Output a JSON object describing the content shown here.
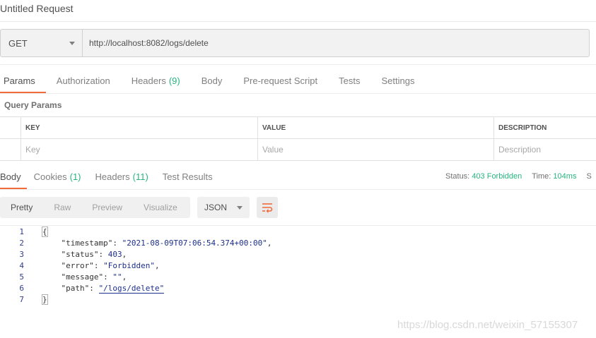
{
  "request": {
    "title": "Untitled Request",
    "method": "GET",
    "url": "http://localhost:8082/logs/delete"
  },
  "request_tabs": [
    {
      "label": "Params",
      "count": "",
      "active": true
    },
    {
      "label": "Authorization",
      "count": "",
      "active": false
    },
    {
      "label": "Headers",
      "count": "(9)",
      "active": false
    },
    {
      "label": "Body",
      "count": "",
      "active": false
    },
    {
      "label": "Pre-request Script",
      "count": "",
      "active": false
    },
    {
      "label": "Tests",
      "count": "",
      "active": false
    },
    {
      "label": "Settings",
      "count": "",
      "active": false
    }
  ],
  "query_params": {
    "label": "Query Params",
    "headers": {
      "key": "KEY",
      "value": "VALUE",
      "description": "DESCRIPTION"
    },
    "placeholders": {
      "key": "Key",
      "value": "Value",
      "description": "Description"
    }
  },
  "response_tabs": [
    {
      "label": "Body",
      "count": "",
      "active": true
    },
    {
      "label": "Cookies",
      "count": "(1)",
      "active": false
    },
    {
      "label": "Headers",
      "count": "(11)",
      "active": false
    },
    {
      "label": "Test Results",
      "count": "",
      "active": false
    }
  ],
  "response_status": {
    "status_label": "Status:",
    "status_value": "403 Forbidden",
    "time_label": "Time:",
    "time_value": "104ms",
    "cut_char": "S"
  },
  "view_modes": [
    "Pretty",
    "Raw",
    "Preview",
    "Visualize"
  ],
  "format": "JSON",
  "code": {
    "lines": [
      "1",
      "2",
      "3",
      "4",
      "5",
      "6",
      "7"
    ],
    "open_brace": "{",
    "close_brace": "}",
    "timestamp_key": "\"timestamp\"",
    "timestamp_val": "\"2021-08-09T07:06:54.374+00:00\"",
    "status_key": "\"status\"",
    "status_val": "403",
    "error_key": "\"error\"",
    "error_val": "\"Forbidden\"",
    "message_key": "\"message\"",
    "message_val": "\"\"",
    "path_key": "\"path\"",
    "path_val": "\"/logs/delete\""
  },
  "watermark": "https://blog.csdn.net/weixin_57155307",
  "colors": {
    "accent": "#f26b3a",
    "success": "#26b47f"
  }
}
